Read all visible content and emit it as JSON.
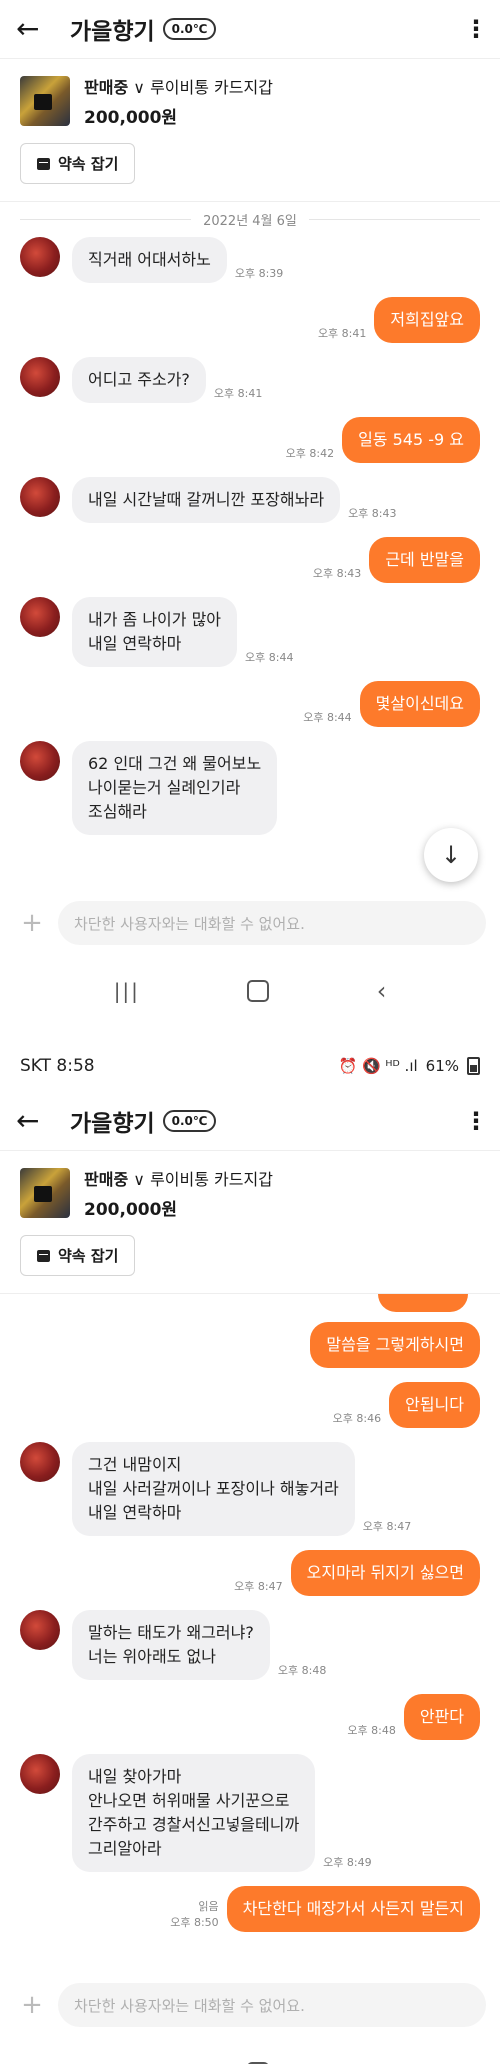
{
  "screen1": {
    "header": {
      "nickname": "가을향기",
      "temperature": "0.0℃"
    },
    "product": {
      "status": "판매중",
      "dropdown": "∨",
      "title": "루이비통 카드지갑",
      "price": "200,000원"
    },
    "promise_button": "약속 잡기",
    "date": "2022년 4월 6일",
    "messages": [
      {
        "dir": "in",
        "text": "직거래 어대서하노",
        "time": "오후 8:39"
      },
      {
        "dir": "out",
        "text": "저희집앞요",
        "time": "오후 8:41"
      },
      {
        "dir": "in",
        "text": "어디고 주소가?",
        "time": "오후 8:41"
      },
      {
        "dir": "out",
        "text": "일동 545 -9 요",
        "time": "오후 8:42"
      },
      {
        "dir": "in",
        "text": "내일 시간날때 갈꺼니깐 포장해놔라",
        "time": "오후 8:43"
      },
      {
        "dir": "out",
        "text": "근데 반말을",
        "time": "오후 8:43"
      },
      {
        "dir": "in",
        "text": "내가 좀 나이가 많아\n내일 연락하마",
        "time": "오후 8:44"
      },
      {
        "dir": "out",
        "text": "몇살이신데요",
        "time": "오후 8:44"
      },
      {
        "dir": "in",
        "text": "62 인대 그건 왜 물어보노\n나이묻는거 실례인기라\n조심해라",
        "time": ""
      }
    ],
    "scroll_icon": "arrow-down",
    "input_placeholder": "차단한 사용자와는 대화할 수 없어요.",
    "nav": {
      "recent": "|||",
      "back": "‹"
    }
  },
  "screen2": {
    "status_bar": {
      "carrier": "SKT",
      "clock": "8:58",
      "icons": "⏰ 🔇 ᴴᴰ .ıl",
      "battery": "61%"
    },
    "header": {
      "nickname": "가을향기",
      "temperature": "0.0℃"
    },
    "product": {
      "status": "판매중",
      "dropdown": "∨",
      "title": "루이비통 카드지갑",
      "price": "200,000원"
    },
    "promise_button": "약속 잡기",
    "messages": [
      {
        "dir": "out",
        "text": "말씀을 그렇게하시면",
        "time": ""
      },
      {
        "dir": "out",
        "text": "안됩니다",
        "time": "오후 8:46"
      },
      {
        "dir": "in",
        "text": "그건 내맘이지\n 내일 사러갈꺼이나 포장이나 해놓거라\n내일 연락하마",
        "time": "오후 8:47"
      },
      {
        "dir": "out",
        "text": "오지마라 뒤지기 싫으면",
        "time": "오후 8:47"
      },
      {
        "dir": "in",
        "text": "말하는 태도가 왜그러냐?\n너는 위아래도 없나",
        "time": "오후 8:48"
      },
      {
        "dir": "out",
        "text": "안판다",
        "time": "오후 8:48"
      },
      {
        "dir": "in",
        "text": "내일 찾아가마\n안나오면 허위매물 사기꾼으로\n간주하고 경찰서신고넣을테니까\n그리알아라",
        "time": "오후 8:49"
      }
    ],
    "last_message": {
      "text": "차단한다 매장가서 사든지 말든지",
      "read": "읽음",
      "time": "오후 8:50"
    },
    "input_placeholder": "차단한 사용자와는 대화할 수 없어요.",
    "nav": {
      "recent": "|||",
      "back": "‹"
    }
  }
}
